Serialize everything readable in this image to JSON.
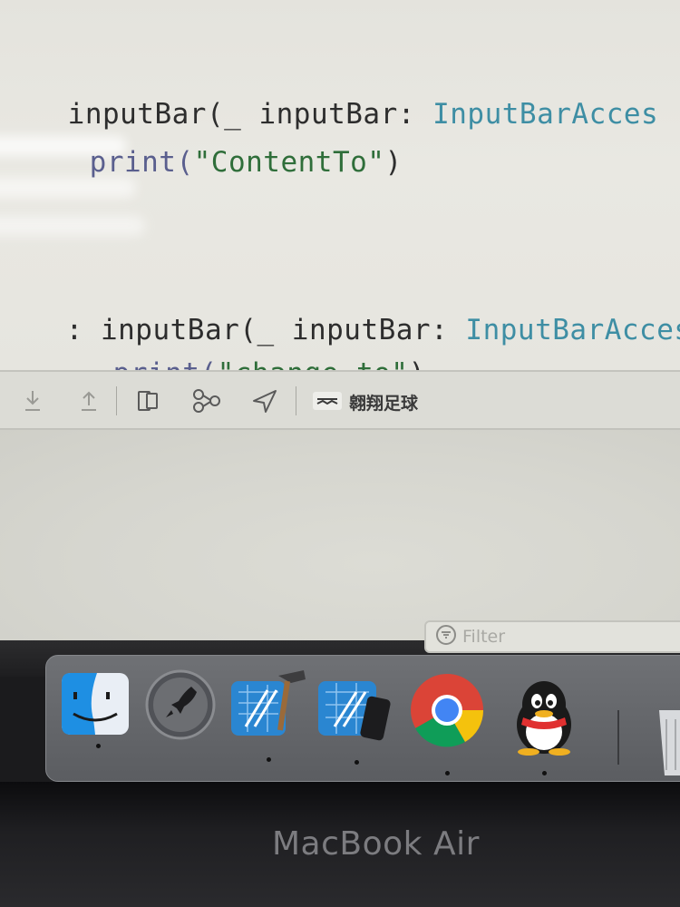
{
  "editor": {
    "lines": [
      {
        "parts": [
          "",
          "inputBar(_ inputBar: ",
          "InputBarAcces"
        ]
      },
      {
        "parts": [
          "",
          "print(",
          "\"ContentTo\"",
          ")"
        ]
      },
      {
        "parts": [
          ": ",
          "inputBar(_ inputBar: ",
          "InputBarAccess"
        ]
      },
      {
        "parts": [
          "",
          "print(",
          "\"change to\"",
          ")"
        ]
      }
    ]
  },
  "debug_bar": {
    "buttons": [
      {
        "name": "step-into-icon"
      },
      {
        "name": "step-out-icon"
      },
      {
        "name": "view-debugger-icon"
      },
      {
        "name": "memory-graph-icon"
      },
      {
        "name": "simulate-location-icon"
      },
      {
        "name": "target-icon"
      }
    ],
    "target_label": "翱翔足球"
  },
  "console": {
    "filter_placeholder": "Filter"
  },
  "dock": {
    "apps": [
      {
        "name": "finder-icon",
        "running": true
      },
      {
        "name": "launchpad-icon",
        "running": false
      },
      {
        "name": "xcode-icon",
        "running": true
      },
      {
        "name": "simulator-icon",
        "running": true
      },
      {
        "name": "chrome-icon",
        "running": true
      },
      {
        "name": "qq-icon",
        "running": true
      },
      {
        "name": "trash-icon",
        "running": false
      }
    ]
  },
  "bezel": {
    "brand": "MacBook Air"
  },
  "colors": {
    "type_teal": "#3e8ea4",
    "string_green": "#2f6e3a",
    "keyword_dark": "#2d2d2d"
  }
}
